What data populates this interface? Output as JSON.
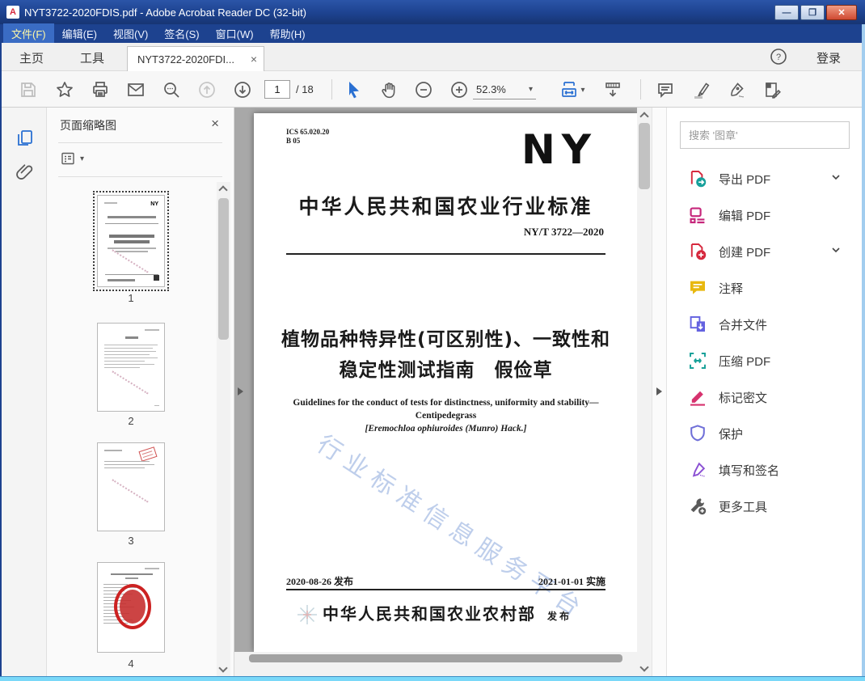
{
  "window": {
    "title": "NYT3722-2020FDIS.pdf - Adobe Acrobat Reader DC (32-bit)",
    "app_icon_letter": "A"
  },
  "menu": {
    "items": [
      "文件(F)",
      "编辑(E)",
      "视图(V)",
      "签名(S)",
      "窗口(W)",
      "帮助(H)"
    ]
  },
  "tabs": {
    "home": "主页",
    "tools": "工具",
    "doc": "NYT3722-2020FDI...",
    "doc_close": "×",
    "sign_in": "登录"
  },
  "toolbar": {
    "page_current": "1",
    "page_total": "/ 18",
    "zoom_level": "52.3%",
    "icons": [
      "save-icon",
      "star-icon",
      "print-icon",
      "email-icon",
      "search-icon",
      "page-up-icon",
      "page-down-icon",
      "select-tool-icon",
      "hand-tool-icon",
      "zoom-out-icon",
      "zoom-in-icon",
      "fit-width-icon",
      "page-display-icon",
      "comment-icon",
      "highlight-icon",
      "sign-icon",
      "stamp-sign-icon"
    ]
  },
  "thumbnails_panel": {
    "title": "页面缩略图",
    "close": "×",
    "pages": [
      "1",
      "2",
      "3",
      "4"
    ]
  },
  "document": {
    "ics_line1": "ICS 65.020.20",
    "ics_line2": "B 05",
    "logo": "NY",
    "standard_header": "中华人民共和国农业行业标准",
    "standard_number": "NY/T 3722—2020",
    "title_line1": "植物品种特异性(可区别性)、一致性和",
    "title_line2": "稳定性测试指南　假俭草",
    "subtitle_en_line1": "Guidelines for the conduct of tests for distinctness, uniformity and stability—",
    "subtitle_en_line2": "Centipedegrass",
    "latin_name": "[Eremochloa ophiuroides (Munro) Hack.]",
    "watermark": "行业标准信息服务平台",
    "issue_date": "2020-08-26 发布",
    "impl_date": "2021-01-01 实施",
    "publisher": "中华人民共和国农业农村部",
    "publisher_suffix": "发 布"
  },
  "tools_panel": {
    "search_placeholder": "搜索 '图章'",
    "tools": [
      {
        "label": "导出 PDF",
        "icon": "export-pdf-icon",
        "color": "#17a09b",
        "chevron": true
      },
      {
        "label": "编辑 PDF",
        "icon": "edit-pdf-icon",
        "color": "#c6267b",
        "chevron": false
      },
      {
        "label": "创建 PDF",
        "icon": "create-pdf-icon",
        "color": "#d6293e",
        "chevron": true
      },
      {
        "label": "注释",
        "icon": "comment-icon",
        "color": "#e8b80f",
        "chevron": false
      },
      {
        "label": "合并文件",
        "icon": "combine-files-icon",
        "color": "#6462e0",
        "chevron": false
      },
      {
        "label": "压缩 PDF",
        "icon": "compress-pdf-icon",
        "color": "#18a199",
        "chevron": false
      },
      {
        "label": "标记密文",
        "icon": "redact-icon",
        "color": "#d6326e",
        "chevron": false
      },
      {
        "label": "保护",
        "icon": "protect-icon",
        "color": "#6f6fd8",
        "chevron": false
      },
      {
        "label": "填写和签名",
        "icon": "fill-sign-icon",
        "color": "#8a4fd3",
        "chevron": false
      },
      {
        "label": "更多工具",
        "icon": "more-tools-icon",
        "color": "#5a5a5a",
        "chevron": false
      }
    ]
  }
}
